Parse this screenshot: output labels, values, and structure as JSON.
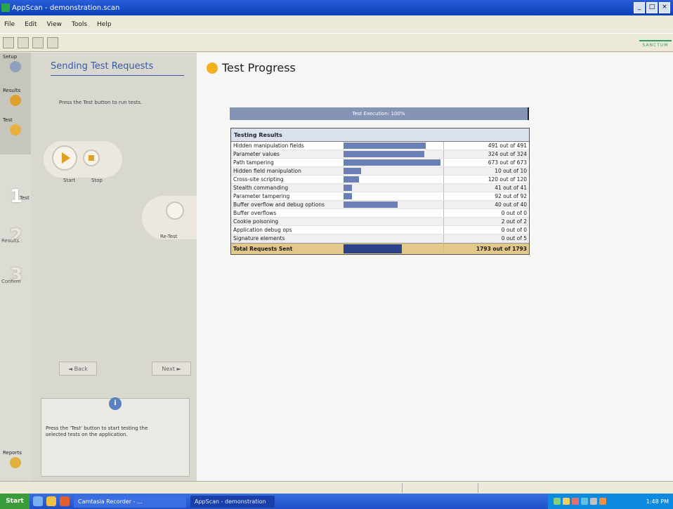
{
  "window": {
    "title": "AppScan - demonstration.scan",
    "controls": [
      "_",
      "□",
      "×"
    ]
  },
  "menu": [
    "File",
    "Edit",
    "View",
    "Tools",
    "Help"
  ],
  "brand": {
    "text": "SANCTUM"
  },
  "strip": {
    "setup_label": "Setup",
    "results_label": "Results",
    "test_label": "Test",
    "step1_label": "Test",
    "step2_label": "Results",
    "step3_label": "Confirm",
    "reports_label": "Reports"
  },
  "wizard": {
    "title": "Sending Test Requests",
    "description": "Press the Test button to run tests.",
    "start_label": "Start",
    "stop_label": "Stop",
    "fix_label": "Re-Test",
    "back_label": "◄ Back",
    "next_label": "Next ►",
    "info_text": "Press the 'Test' button to start testing the selected tests on the application."
  },
  "main": {
    "title": "Test Progress",
    "progress_text": "Test Execution: 100%",
    "table_header": "Testing Results",
    "rows": [
      {
        "name": "Hidden manipulation fields",
        "value": "491 out of 491",
        "fraction": 0.85
      },
      {
        "name": "Parameter values",
        "value": "324 out of 324",
        "fraction": 0.83
      },
      {
        "name": "Path tampering",
        "value": "673 out of 673",
        "fraction": 1.0
      },
      {
        "name": "Hidden field manipulation",
        "value": "10 out of 10",
        "fraction": 0.18
      },
      {
        "name": "Cross-site scripting",
        "value": "120 out of 120",
        "fraction": 0.16
      },
      {
        "name": "Stealth commanding",
        "value": "41 out of 41",
        "fraction": 0.09
      },
      {
        "name": "Parameter tampering",
        "value": "92 out of 92",
        "fraction": 0.09
      },
      {
        "name": "Buffer overflow and debug options",
        "value": "40 out of 40",
        "fraction": 0.56
      },
      {
        "name": "Buffer overflows",
        "value": "0 out of 0",
        "fraction": 0
      },
      {
        "name": "Cookie poisoning",
        "value": "2 out of 2",
        "fraction": 0
      },
      {
        "name": "Application debug ops",
        "value": "0 out of 0",
        "fraction": 0
      },
      {
        "name": "Signature elements",
        "value": "0 out of 5",
        "fraction": 0
      }
    ],
    "total": {
      "name": "Total Requests Sent",
      "value": "1793 out of 1793",
      "fraction": 0.6
    }
  },
  "taskbar": {
    "start": "Start",
    "task1": "Camtasia Recorder - ...",
    "task2": "AppScan - demonstration",
    "clock": "1:48 PM"
  },
  "colors": {
    "accent": "#3a5aa0",
    "bar": "#6a7fb5",
    "total_bar": "#2c4288",
    "total_bg": "#e2c98a"
  }
}
